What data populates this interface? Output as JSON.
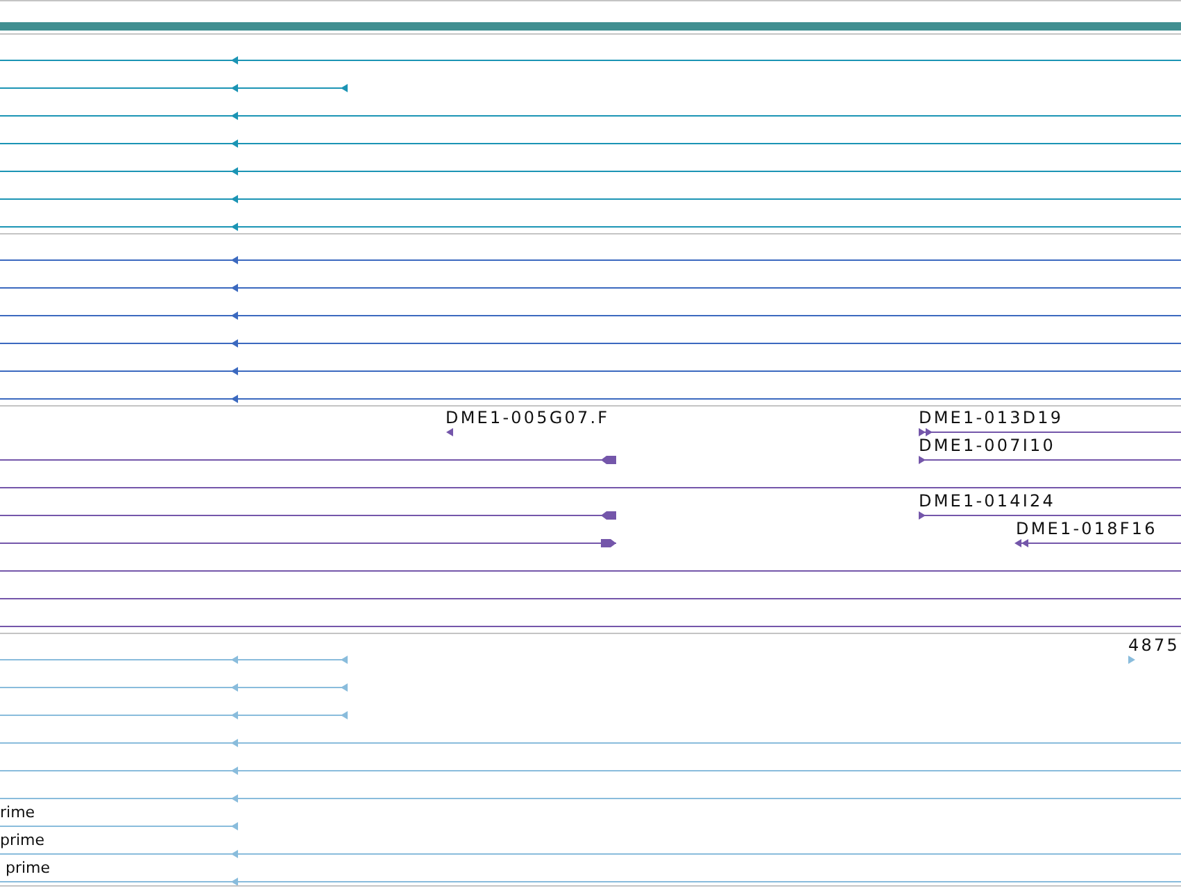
{
  "tracks": [
    {
      "color": "#1b94b4",
      "rows": [
        {
          "glyphs": [
            {
              "kind": "arrow",
              "reverse": true
            }
          ]
        },
        {
          "glyphs": [
            {
              "kind": "arrow",
              "reverse": true
            },
            {
              "kind": "arrow",
              "reverse": true
            }
          ]
        },
        {
          "glyphs": [
            {
              "kind": "arrow",
              "reverse": true
            }
          ]
        },
        {
          "glyphs": [
            {
              "kind": "arrow",
              "reverse": true
            }
          ]
        },
        {
          "glyphs": [
            {
              "kind": "arrow",
              "reverse": true
            }
          ]
        },
        {
          "glyphs": [
            {
              "kind": "arrow",
              "reverse": true
            }
          ]
        },
        {
          "glyphs": [
            {
              "kind": "arrow",
              "reverse": true
            }
          ]
        }
      ]
    },
    {
      "color": "#3b69bf",
      "rows": [
        {
          "glyphs": [
            {
              "kind": "arrow",
              "reverse": true
            }
          ]
        },
        {
          "glyphs": [
            {
              "kind": "arrow",
              "reverse": true
            }
          ]
        },
        {
          "glyphs": [
            {
              "kind": "arrow",
              "reverse": true
            }
          ]
        },
        {
          "glyphs": [
            {
              "kind": "arrow",
              "reverse": true
            }
          ]
        },
        {
          "glyphs": [
            {
              "kind": "arrow",
              "reverse": true
            }
          ]
        },
        {
          "glyphs": [
            {
              "kind": "arrow",
              "reverse": true
            }
          ]
        }
      ]
    },
    {
      "color": "#7456aa",
      "rows": [
        {
          "glyphs": [
            {
              "kind": "arrow",
              "reverse": true,
              "label": "DME1-005G07.F"
            },
            {
              "kind": "double-arrow",
              "reverse": false,
              "label": "DME1-013D19"
            }
          ]
        },
        {
          "glyphs": [
            {
              "kind": "block-arrow",
              "reverse": true
            },
            {
              "kind": "arrow",
              "reverse": false,
              "label": "DME1-007I10"
            }
          ]
        },
        {},
        {
          "glyphs": [
            {
              "kind": "block-arrow",
              "reverse": true
            },
            {
              "kind": "arrow",
              "reverse": false,
              "label": "DME1-014I24"
            }
          ]
        },
        {
          "glyphs": [
            {
              "kind": "block-arrow",
              "reverse": false
            },
            {
              "kind": "double-arrow",
              "reverse": true,
              "label": "DME1-018F16"
            }
          ]
        },
        {},
        {},
        {}
      ]
    },
    {
      "color": "#89bcdc",
      "rows": [
        {
          "glyphs": [
            {
              "kind": "arrow",
              "reverse": true
            },
            {
              "kind": "arrow",
              "reverse": true
            },
            {
              "kind": "arrow",
              "reverse": false,
              "label": "4875"
            }
          ]
        },
        {
          "glyphs": [
            {
              "kind": "arrow",
              "reverse": true
            },
            {
              "kind": "arrow",
              "reverse": true
            }
          ]
        },
        {
          "glyphs": [
            {
              "kind": "arrow",
              "reverse": true
            },
            {
              "kind": "arrow",
              "reverse": true
            }
          ]
        },
        {
          "glyphs": [
            {
              "kind": "arrow",
              "reverse": true
            }
          ]
        },
        {
          "glyphs": [
            {
              "kind": "arrow",
              "reverse": true
            }
          ]
        },
        {
          "glyphs": [
            {
              "kind": "arrow",
              "reverse": true
            }
          ]
        },
        {
          "glyphs": [
            {
              "kind": "arrow",
              "reverse": true,
              "label": "rime"
            }
          ]
        },
        {
          "glyphs": [
            {
              "kind": "arrow",
              "reverse": true,
              "label": "prime"
            }
          ]
        },
        {
          "glyphs": [
            {
              "kind": "arrow",
              "reverse": true,
              "label": "prime"
            }
          ]
        }
      ]
    }
  ]
}
